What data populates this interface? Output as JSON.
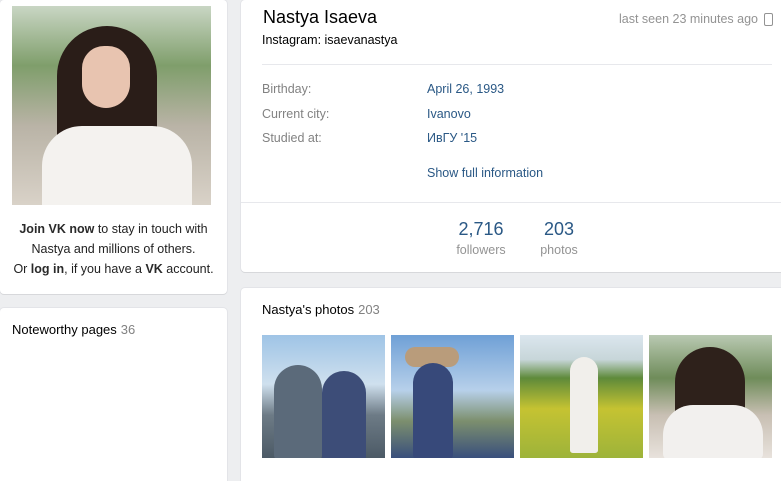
{
  "profile": {
    "name": "Nastya Isaeva",
    "status": "Instagram: isaevanastya",
    "last_seen": "last seen 23 minutes ago"
  },
  "info": [
    {
      "label": "Birthday:",
      "value": "April 26, 1993"
    },
    {
      "label": "Current city:",
      "value": "Ivanovo"
    },
    {
      "label": "Studied at:",
      "value": "ИвГУ '15"
    }
  ],
  "show_full_label": "Show full information",
  "counters": [
    {
      "num": "2,716",
      "label": "followers"
    },
    {
      "num": "203",
      "label": "photos"
    }
  ],
  "join": {
    "link": "Join VK now",
    "text1": " to stay in touch with",
    "line2": "Nastya and millions of others.",
    "or": "Or ",
    "login": "log in",
    "text3": ", if you have a ",
    "vk": "VK",
    "text4": " account."
  },
  "noteworthy": {
    "title": "Noteworthy pages",
    "count": "36"
  },
  "photos_block": {
    "title": "Nastya's photos",
    "count": "203"
  },
  "photos": [
    {
      "icon": "photo-couple"
    },
    {
      "icon": "photo-hat"
    },
    {
      "icon": "photo-field"
    },
    {
      "icon": "photo-portrait"
    }
  ],
  "icons": {
    "phone": "phone-icon"
  },
  "colors": {
    "link": "#2a5885",
    "muted": "#939393",
    "background": "#edeef0"
  }
}
